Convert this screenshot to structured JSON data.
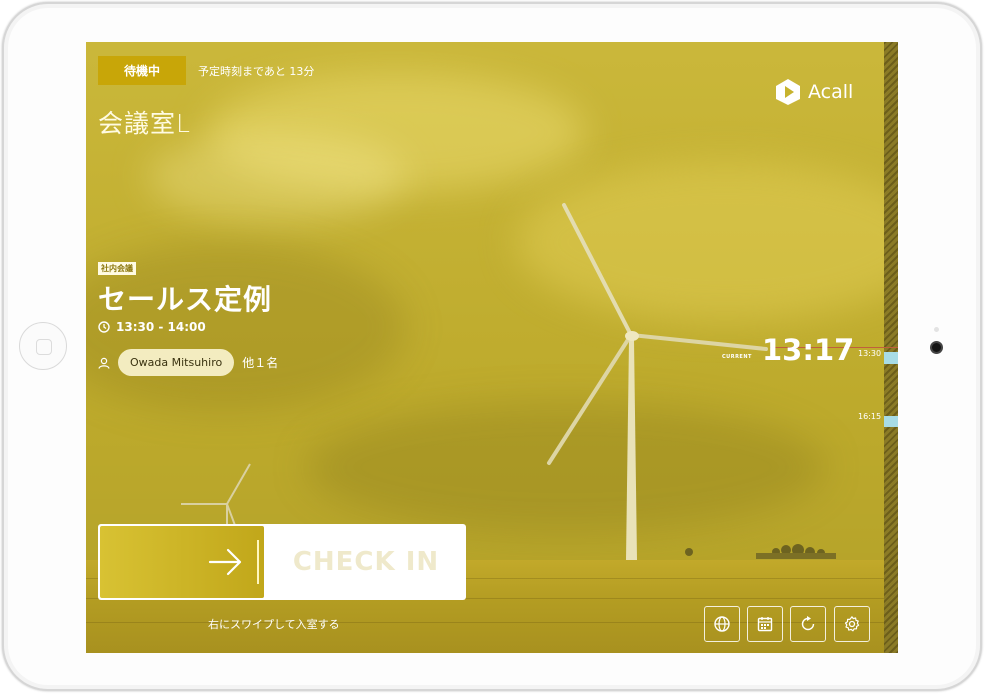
{
  "status": {
    "badge": "待機中",
    "message": "予定時刻まであと 13分"
  },
  "room": {
    "name": "会議室L"
  },
  "brand": {
    "name": "Acall",
    "icon": "play-logo-icon"
  },
  "meeting": {
    "category": "社内会議",
    "title": "セールス定例",
    "time": "13:30 - 14:00",
    "attendee": "Owada Mitsuhiro",
    "others": "他１名"
  },
  "timeline": {
    "current_label": "CURRENT",
    "current_time": "13:17",
    "ticks": [
      "13:30",
      "16:15"
    ]
  },
  "checkin": {
    "label": "CHECK IN",
    "hint": "右にスワイプして入室する"
  },
  "controls": [
    {
      "name": "language-button",
      "icon": "globe-icon"
    },
    {
      "name": "calendar-button",
      "icon": "calendar-icon"
    },
    {
      "name": "refresh-button",
      "icon": "refresh-icon"
    },
    {
      "name": "settings-button",
      "icon": "gear-icon"
    }
  ],
  "colors": {
    "overlay": "#c7b32e",
    "badge": "#c8a608",
    "free_slot": "#a8dce6",
    "current_line": "#c0603c"
  }
}
